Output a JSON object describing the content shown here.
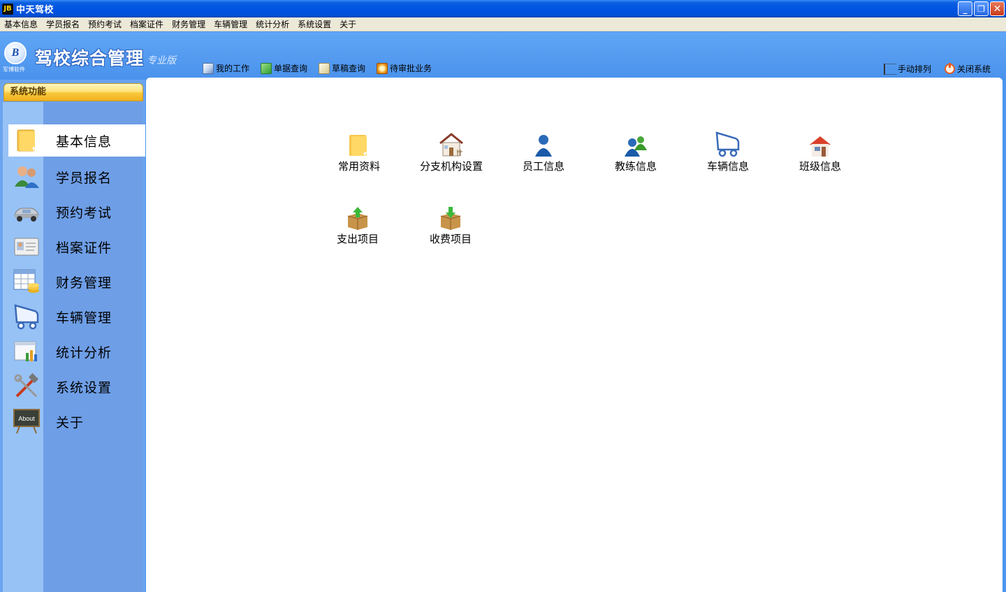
{
  "window": {
    "title": "中天驾校"
  },
  "menu": [
    "基本信息",
    "学员报名",
    "预约考试",
    "档案证件",
    "财务管理",
    "车辆管理",
    "统计分析",
    "系统设置",
    "关于"
  ],
  "header": {
    "brand": "驾校综合管理",
    "edition": "专业版",
    "company": "军博软件",
    "logo_letter": "B"
  },
  "toolbar": {
    "my_work": "我的工作",
    "doc_query": "单据查询",
    "draft_query": "草稿查询",
    "pending": "待审批业务",
    "manual_arrange": "手动排列",
    "close_system": "关闭系统"
  },
  "sidebar": {
    "title": "系统功能",
    "items": [
      {
        "label": "基本信息",
        "icon": "folder-icon"
      },
      {
        "label": "学员报名",
        "icon": "users-icon"
      },
      {
        "label": "预约考试",
        "icon": "car-icon"
      },
      {
        "label": "档案证件",
        "icon": "id-card-icon"
      },
      {
        "label": "财务管理",
        "icon": "spreadsheet-coins-icon"
      },
      {
        "label": "车辆管理",
        "icon": "cart-icon"
      },
      {
        "label": "统计分析",
        "icon": "chart-icon"
      },
      {
        "label": "系统设置",
        "icon": "tools-icon"
      },
      {
        "label": "关于",
        "icon": "about-board-icon"
      }
    ],
    "active_index": 0
  },
  "content": {
    "items": [
      {
        "label": "常用资料",
        "icon": "folder-icon"
      },
      {
        "label": "分支机构设置",
        "icon": "house-icon"
      },
      {
        "label": "员工信息",
        "icon": "person-icon"
      },
      {
        "label": "教练信息",
        "icon": "people-icon"
      },
      {
        "label": "车辆信息",
        "icon": "cart-icon"
      },
      {
        "label": "班级信息",
        "icon": "building-icon"
      },
      {
        "label": "支出项目",
        "icon": "box-up-icon"
      },
      {
        "label": "收费项目",
        "icon": "box-down-icon"
      }
    ]
  },
  "colors": {
    "accent": "#4d96ee",
    "titlebar": "#0054e3",
    "sidebar_header": "#f8c83a"
  },
  "about_icon_text": "About"
}
